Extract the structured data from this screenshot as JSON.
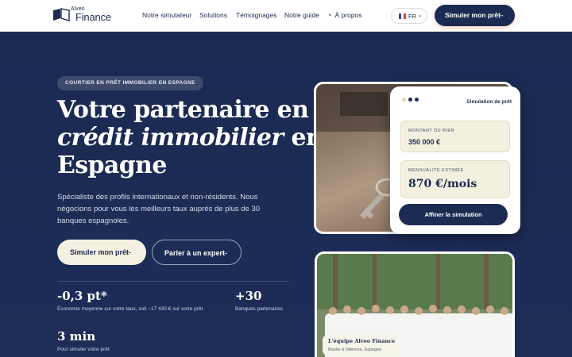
{
  "header": {
    "logo_small": "Alveo",
    "logo_big": "Finance",
    "nav": [
      "Notre simulateur",
      "Solutions",
      "Témoignages",
      "Notre guide",
      "À propos"
    ],
    "lang": "FR",
    "cta": "Simuler mon prêt"
  },
  "hero": {
    "badge": "COURTIER EN PRÊT IMMOBILIER EN ESPAGNE",
    "title_line1": "Votre partenaire en",
    "title_line2_em": "crédit immobilier",
    "title_line2_rest": " en",
    "title_line3": "Espagne",
    "subtitle": "Spécialiste des profils internationaux et non-résidents. Nous négocions pour vous les meilleurs taux auprès de plus de 30 banques espagnoles.",
    "btn_primary": "Simuler mon prêt",
    "btn_secondary": "Parler à un expert",
    "stats": [
      {
        "value": "-0,3 pt*",
        "label": "Économie moyenne sur votre taux, soit ~17 430 € sur votre prêt"
      },
      {
        "value": "+30",
        "label": "Banques partenaires"
      },
      {
        "value": "3 min",
        "label": "Pour simuler votre prêt"
      }
    ]
  },
  "simulation": {
    "title": "Simulation de prêt",
    "field1_label": "MONTANT DU BIEN",
    "field1_value": "350 000 €",
    "field2_label": "MENSUALITÉ ESTIMÉE",
    "field2_value": "870 €/mois",
    "button": "Affiner la simulation"
  },
  "team_card": {
    "title": "L'équipe Alveo Finance",
    "subtitle": "Basée à Valencia, Espagne"
  },
  "icons": {
    "arrow": "→",
    "chevron": "⌄"
  },
  "colors": {
    "navy": "#1c2b52",
    "cream": "#f4f0e2",
    "flag_blue": "#1f4fa8",
    "flag_white": "#ffffff",
    "flag_red": "#e23b3b"
  }
}
